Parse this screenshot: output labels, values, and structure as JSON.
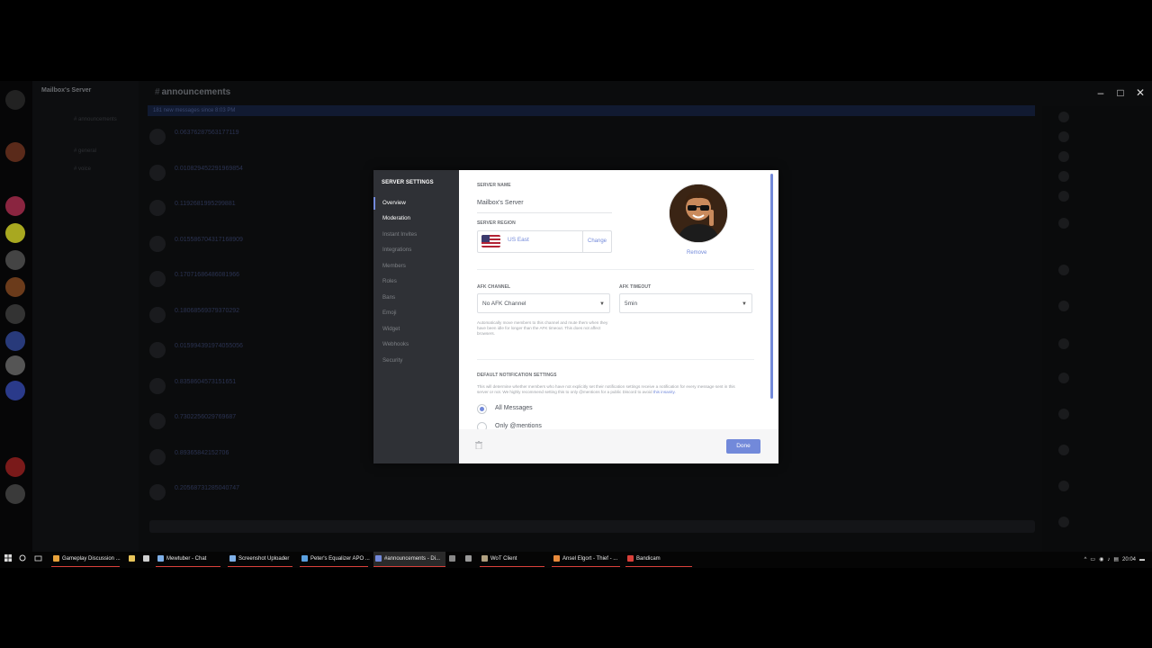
{
  "window": {
    "controls": [
      "–",
      "□",
      "✕"
    ]
  },
  "sidebar": {
    "server_title": "Mailbox's Server"
  },
  "channel": {
    "name": "announcements",
    "new_messages_bar": "181 new messages since 8:03 PM"
  },
  "messages": [
    {
      "text": "0.06376287563177119"
    },
    {
      "text": "0.010829452291969854"
    },
    {
      "text": "0.1192681995299881"
    },
    {
      "text": "0.015586704317168909"
    },
    {
      "text": "0.17071686486081966"
    },
    {
      "text": "0.18068569379370292"
    },
    {
      "text": "0.015994391974055056"
    },
    {
      "text": "0.8358604573151651"
    },
    {
      "text": "0.7302256029769687"
    },
    {
      "text": "0.89365842152706"
    },
    {
      "text": "0.20568731285040747"
    }
  ],
  "modal": {
    "nav_header": "SERVER SETTINGS",
    "nav_items": [
      "Overview",
      "Moderation",
      "Instant Invites",
      "Integrations",
      "Members",
      "Roles",
      "Bans",
      "Emoji",
      "Widget",
      "Webhooks",
      "Security"
    ],
    "server_name_label": "SERVER NAME",
    "server_name_value": "Mailbox's Server",
    "server_region_label": "SERVER REGION",
    "region_value": "US East",
    "change_label": "Change",
    "remove_label": "Remove",
    "afk_channel_label": "AFK CHANNEL",
    "afk_channel_value": "No AFK Channel",
    "afk_timeout_label": "AFK TIMEOUT",
    "afk_timeout_value": "5min",
    "afk_help": "Automatically move members to this channel and mute them when they have been idle for longer than the AFK timeout. This does not affect browsers.",
    "notif_label": "DEFAULT NOTIFICATION SETTINGS",
    "notif_help": "This will determine whether members who have not explicitly set their notification settings receive a notification for every message sent in this server or not. We highly recommend setting this to only @mentions for a public Discord to avoid",
    "notif_help_link": "this insanity.",
    "radio_options": [
      "All Messages",
      "Only @mentions"
    ],
    "selected_option": "All Messages",
    "done_label": "Done",
    "accent": "#7289da"
  },
  "taskbar": {
    "items": [
      {
        "label": "Gameplay Discussion ...",
        "icon_color": "#e8a33c"
      },
      {
        "label": "",
        "icon_color": "#e8c45a"
      },
      {
        "label": "",
        "icon_color": "#cfcfcf"
      },
      {
        "label": "Mewtuber - Chat",
        "icon_color": "#7fb0e8"
      },
      {
        "label": "Screenshot Uploader",
        "icon_color": "#7fb0e8"
      },
      {
        "label": "Peter's Equalizer APO ...",
        "icon_color": "#5aa0e0"
      },
      {
        "label": "#announcements - Di...",
        "icon_color": "#7289da"
      },
      {
        "label": "",
        "icon_color": "#888888"
      },
      {
        "label": "",
        "icon_color": "#999999"
      },
      {
        "label": "WoT Client",
        "icon_color": "#b0a080"
      },
      {
        "label": "Ansel Elgort - Thief - ...",
        "icon_color": "#e88a3c"
      },
      {
        "label": "Bandicam",
        "icon_color": "#d9403a"
      }
    ],
    "clock": "20:04",
    "tray_icons": [
      "^",
      "▭",
      "◉",
      "♪",
      "▤",
      "▬"
    ]
  }
}
